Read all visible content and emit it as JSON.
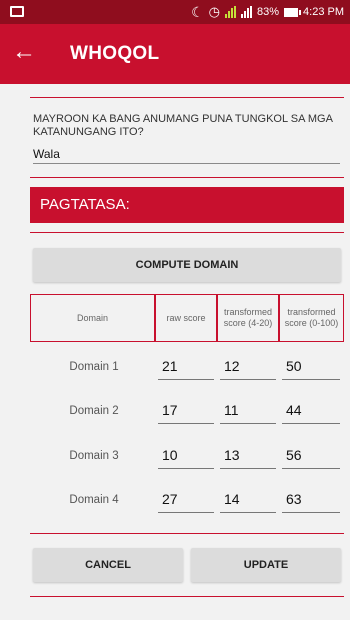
{
  "status_bar": {
    "battery": "83%",
    "time": "4:23 PM",
    "icons": [
      "image-icon",
      "moon-icon",
      "alarm-icon",
      "signal-icon",
      "battery-icon"
    ]
  },
  "app_bar": {
    "title": "WHOQOL",
    "back_icon": "arrow-back-icon"
  },
  "question": {
    "text": "MAYROON KA BANG ANUMANG PUNA TUNGKOL SA MGA KATANUNGANG ITO?",
    "answer": "Wala"
  },
  "section": {
    "title": "PAGTATASA:"
  },
  "compute_button": "COMPUTE DOMAIN",
  "table": {
    "headers": [
      "Domain",
      "raw score",
      "transformed score (4-20)",
      "transformed score (0-100)"
    ],
    "rows": [
      {
        "domain": "Domain 1",
        "raw": "21",
        "t20": "12",
        "t100": "50"
      },
      {
        "domain": "Domain 2",
        "raw": "17",
        "t20": "11",
        "t100": "44"
      },
      {
        "domain": "Domain 3",
        "raw": "10",
        "t20": "13",
        "t100": "56"
      },
      {
        "domain": "Domain 4",
        "raw": "27",
        "t20": "14",
        "t100": "63"
      }
    ]
  },
  "buttons": {
    "cancel": "CANCEL",
    "update": "UPDATE"
  },
  "colors": {
    "primary": "#c8102e",
    "status_bar": "#8f0d1e",
    "background": "#f2f2f2",
    "button": "#dcdcdc"
  }
}
